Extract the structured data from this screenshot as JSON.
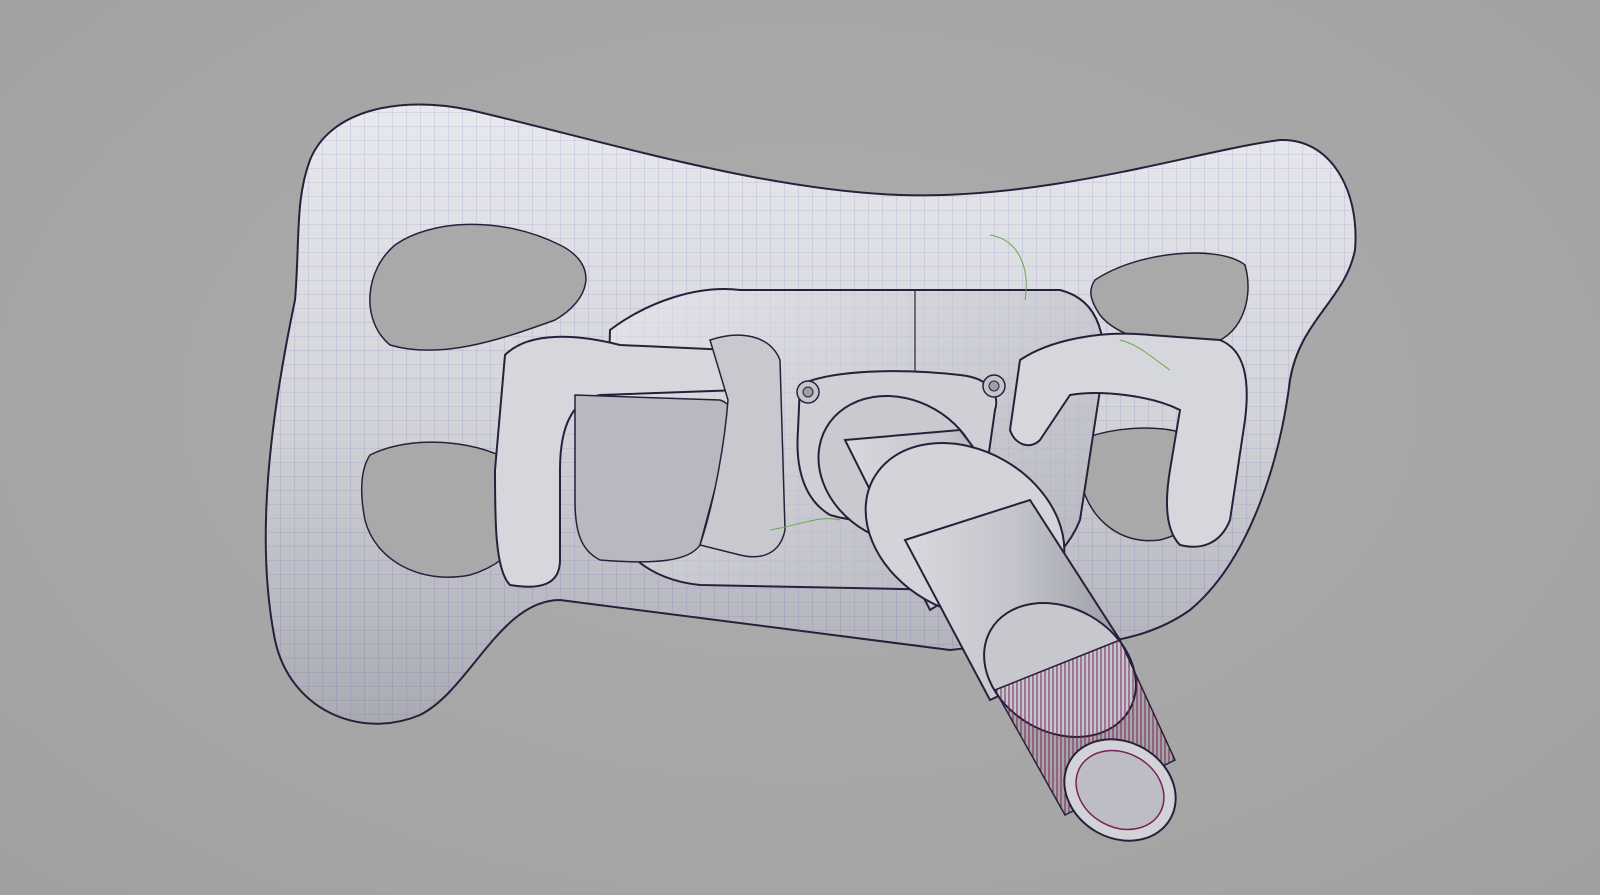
{
  "viewport": {
    "background_color": "#a7a7a7",
    "model": "steering-wheel-surface-model"
  },
  "colors": {
    "surface": "#dcdde2",
    "surface_shadow": "#9fa0a8",
    "isoparm": "#3b3b9a",
    "edge": "#2a1f3a",
    "spline": "#7a1f5a",
    "construction": "#6aa84f"
  }
}
